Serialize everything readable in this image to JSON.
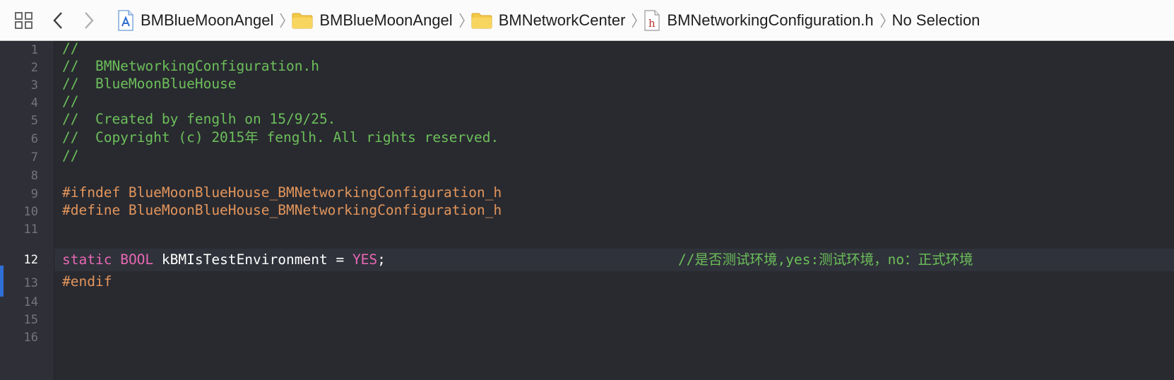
{
  "jumpbar": {
    "crumbs": [
      {
        "label": "BMBlueMoonAngel",
        "icon": "xcode-project-icon"
      },
      {
        "label": "BMBlueMoonAngel",
        "icon": "folder-icon"
      },
      {
        "label": "BMNetworkCenter",
        "icon": "folder-icon"
      },
      {
        "label": "BMNetworkingConfiguration.h",
        "icon": "header-file-icon"
      },
      {
        "label": "No Selection",
        "icon": ""
      }
    ],
    "header_icon_glyph": "h"
  },
  "editor": {
    "line_numbers": [
      "1",
      "2",
      "3",
      "4",
      "5",
      "6",
      "7",
      "8",
      "9",
      "10",
      "11",
      "12",
      "13",
      "14",
      "15",
      "16"
    ],
    "active_line": "12",
    "lines": {
      "l1": "//",
      "l2": "//  BMNetworkingConfiguration.h",
      "l3": "//  BlueMoonBlueHouse",
      "l4": "//",
      "l5": "//  Created by fenglh on 15/9/25.",
      "l6": "//  Copyright (c) 2015年 fenglh. All rights reserved.",
      "l7": "//",
      "l9": "#ifndef BlueMoonBlueHouse_BMNetworkingConfiguration_h",
      "l10": "#define BlueMoonBlueHouse_BMNetworkingConfiguration_h",
      "l12": {
        "kw_static": "static",
        "kw_bool": "BOOL",
        "ident": " kBMIsTestEnvironment = ",
        "kw_yes": "YES",
        "semi": ";",
        "comment": "//是否测试环境,yes:测试环境，no：正式环境"
      },
      "l14": "#endif"
    }
  },
  "colors": {
    "background": "#292a30",
    "gutter": "#2f3037",
    "comment": "#6cbf5a",
    "preprocessor": "#e2955b",
    "keyword": "#e667b3",
    "active_marker": "#2f6fd6"
  }
}
